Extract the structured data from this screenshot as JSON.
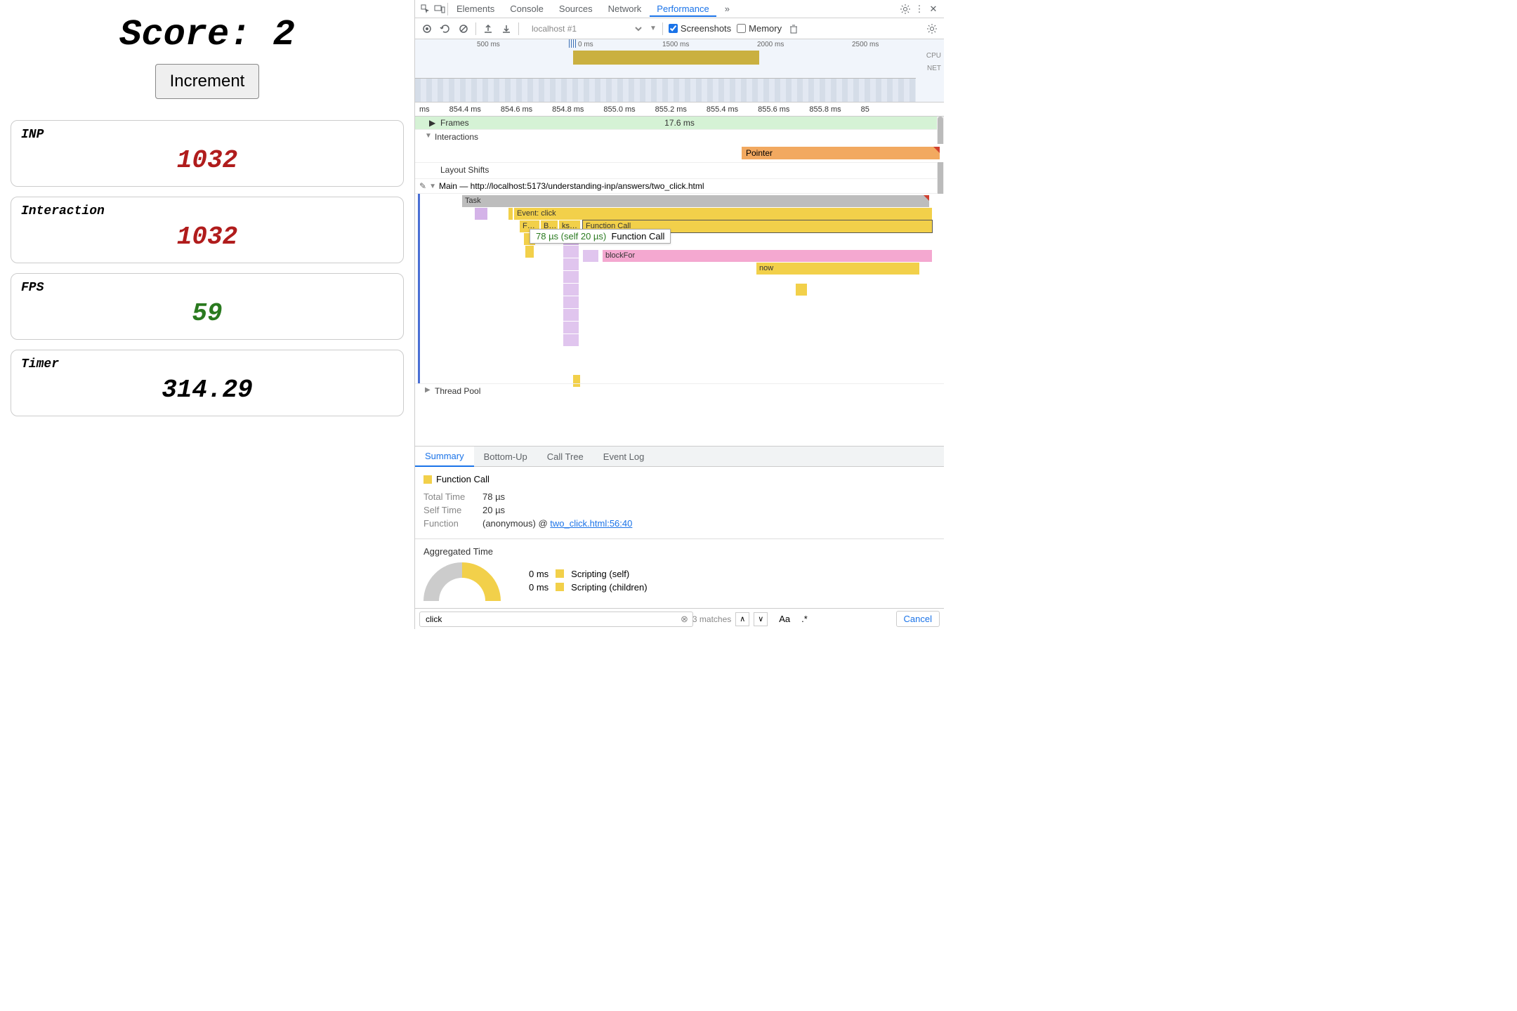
{
  "app": {
    "score_label": "Score:",
    "score_value": "2",
    "increment_label": "Increment",
    "cards": {
      "inp": {
        "label": "INP",
        "value": "1032"
      },
      "interaction": {
        "label": "Interaction",
        "value": "1032"
      },
      "fps": {
        "label": "FPS",
        "value": "59"
      },
      "timer": {
        "label": "Timer",
        "value": "314.29"
      }
    }
  },
  "devtools": {
    "tabs": [
      "Elements",
      "Console",
      "Sources",
      "Network",
      "Performance"
    ],
    "more": "»",
    "toolbar": {
      "page": "localhost #1",
      "screenshots": "Screenshots",
      "memory": "Memory"
    },
    "overview": {
      "ticks": [
        "500 ms",
        "0 ms",
        "1500 ms",
        "2000 ms",
        "2500 ms"
      ],
      "cpu": "CPU",
      "net": "NET"
    },
    "ruler": [
      "ms",
      "854.4 ms",
      "854.6 ms",
      "854.8 ms",
      "855.0 ms",
      "855.2 ms",
      "855.4 ms",
      "855.6 ms",
      "855.8 ms",
      "85"
    ],
    "frames": {
      "label": "Frames",
      "value": "17.6 ms"
    },
    "interactions": {
      "label": "Interactions",
      "pointer": "Pointer"
    },
    "layout_shifts": "Layout Shifts",
    "main": {
      "label": "Main — http://localhost:5173/understanding-inp/answers/two_click.html"
    },
    "flame": {
      "task": "Task",
      "event_click": "Event: click",
      "f": "F…",
      "b": "B…",
      "ks": "ks…",
      "function_call": "Function Call",
      "blockFor": "blockFor",
      "now": "now"
    },
    "tooltip": {
      "time": "78 µs (self 20 µs)",
      "name": "Function Call"
    },
    "thread_pool": "Thread Pool",
    "bottom_tabs": [
      "Summary",
      "Bottom-Up",
      "Call Tree",
      "Event Log"
    ],
    "summary": {
      "title": "Function Call",
      "total_time_k": "Total Time",
      "total_time_v": "78 µs",
      "self_time_k": "Self Time",
      "self_time_v": "20 µs",
      "function_k": "Function",
      "function_v": "(anonymous) @ ",
      "function_link": "two_click.html:56:40"
    },
    "aggregated": {
      "title": "Aggregated Time",
      "rows": [
        {
          "ms": "0 ms",
          "label": "Scripting (self)"
        },
        {
          "ms": "0 ms",
          "label": "Scripting (children)"
        }
      ]
    },
    "search": {
      "query": "click",
      "matches": "3 matches",
      "aa": "Aa",
      "regex": ".*",
      "cancel": "Cancel"
    }
  }
}
